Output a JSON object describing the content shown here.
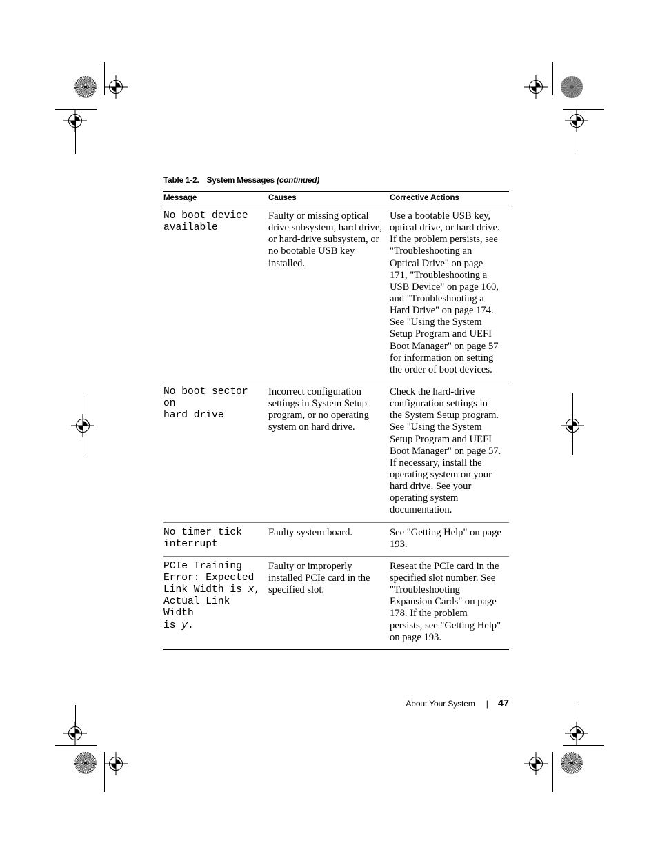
{
  "document": {
    "table_caption": {
      "number": "Table 1-2.",
      "title": "System Messages",
      "continued": "(continued)"
    },
    "columns": [
      "Message",
      "Causes",
      "Corrective Actions"
    ],
    "rows": [
      {
        "message_parts": [
          {
            "text": "No boot device\navailable",
            "italic": false
          }
        ],
        "message": "No boot device available",
        "causes": "Faulty or missing optical drive subsystem, hard drive, or hard-drive subsystem, or no bootable USB key installed.",
        "actions": "Use a bootable USB key, optical drive, or hard drive. If the problem persists, see \"Troubleshooting an Optical Drive\" on page 171, \"Troubleshooting a USB Device\" on page 160, and \"Troubleshooting a Hard Drive\" on page 174. See \"Using the System Setup Program and UEFI Boot Manager\" on page 57 for information on setting the order of boot devices."
      },
      {
        "message_parts": [
          {
            "text": "No boot sector on\nhard drive",
            "italic": false
          }
        ],
        "message": "No boot sector on hard drive",
        "causes": "Incorrect configuration settings in System Setup program, or no operating system on hard drive.",
        "actions": "Check the hard-drive configuration settings in the System Setup program. See \"Using the System Setup Program and UEFI Boot Manager\" on page 57. If necessary, install the operating system on your hard drive. See your operating system documentation."
      },
      {
        "message_parts": [
          {
            "text": "No timer tick\ninterrupt",
            "italic": false
          }
        ],
        "message": "No timer tick interrupt",
        "causes": "Faulty system board.",
        "actions": "See \"Getting Help\" on page 193."
      },
      {
        "message_parts": [
          {
            "text": "PCIe Training\nError: Expected\nLink Width is ",
            "italic": false
          },
          {
            "text": "x",
            "italic": true
          },
          {
            "text": ",\nActual Link Width\nis ",
            "italic": false
          },
          {
            "text": "y",
            "italic": true
          },
          {
            "text": ".",
            "italic": false
          }
        ],
        "message": "PCIe Training Error: Expected Link Width is x, Actual Link Width is y.",
        "causes": "Faulty or improperly installed PCIe card in the specified slot.",
        "actions": "Reseat the PCIe card in the specified slot number. See \"Troubleshooting Expansion Cards\" on page 178. If the problem persists, see \"Getting Help\" on page 193."
      }
    ]
  },
  "footer": {
    "title": "About Your System",
    "separator": "|",
    "page_number": "47"
  }
}
